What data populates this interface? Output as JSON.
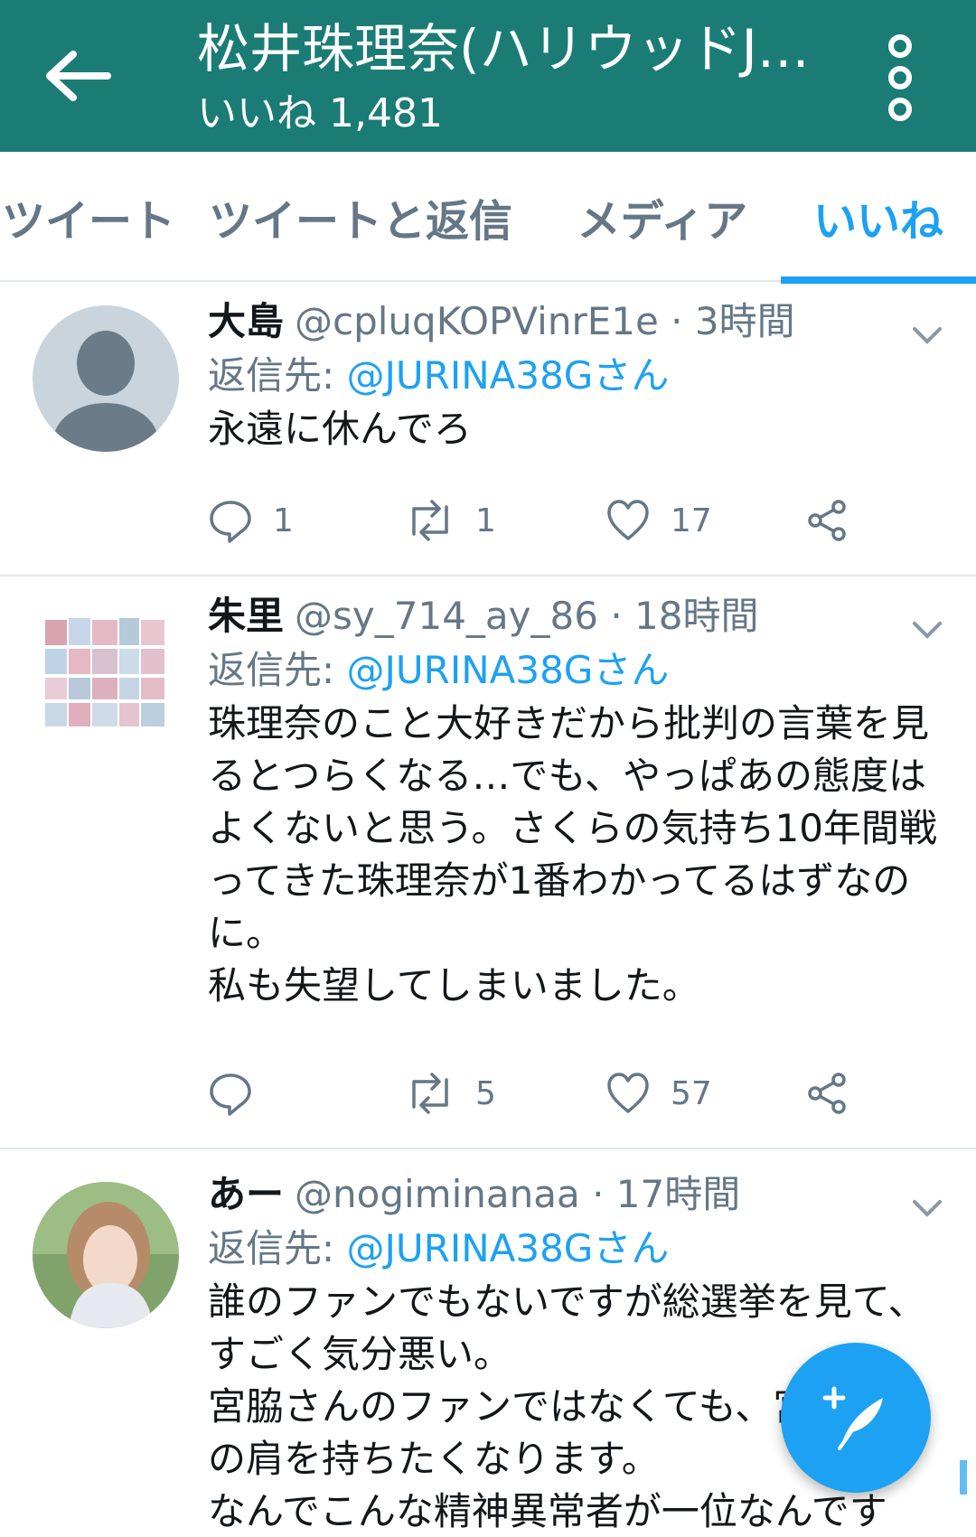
{
  "header": {
    "title": "松井珠理奈(ハリウッドJURINA)",
    "likes_label": "いいね",
    "likes_count": "1,481"
  },
  "tabs": [
    {
      "label": "ツイート",
      "active": false
    },
    {
      "label": "ツイートと返信",
      "active": false
    },
    {
      "label": "メディア",
      "active": false
    },
    {
      "label": "いいね",
      "active": true
    }
  ],
  "tweets": [
    {
      "name": "大島",
      "handle": "@cpluqKOPVinrE1e",
      "time": "· 3時間",
      "reply_label": "返信先:",
      "reply_to": "@JURINA38Gさん",
      "text": "永遠に休んでろ",
      "replies": "1",
      "retweets": "1",
      "likes": "17"
    },
    {
      "name": "朱里",
      "handle": "@sy_714_ay_86",
      "time": "· 18時間",
      "reply_label": "返信先:",
      "reply_to": "@JURINA38Gさん",
      "text": "珠理奈のこと大好きだから批判の言葉を見るとつらくなる…でも、やっぱあの態度はよくないと思う。さくらの気持ち10年間戦ってきた珠理奈が1番わかってるはずなのに。\n私も失望してしまいました。",
      "replies": "",
      "retweets": "5",
      "likes": "57"
    },
    {
      "name": "あー",
      "handle": "@nogiminanaa",
      "time": "· 17時間",
      "reply_label": "返信先:",
      "reply_to": "@JURINA38Gさん",
      "text": "誰のファンでもないですが総選挙を見て、すごく気分悪い。\n宮脇さんのファンではなくても、宮脇さんの肩を持ちたくなります。\nなんでこんな精神異常者が一位なんです"
    }
  ],
  "colors": {
    "appbar": "#1b7c76",
    "accent": "#1da1f2",
    "secondary_text": "#657786"
  }
}
